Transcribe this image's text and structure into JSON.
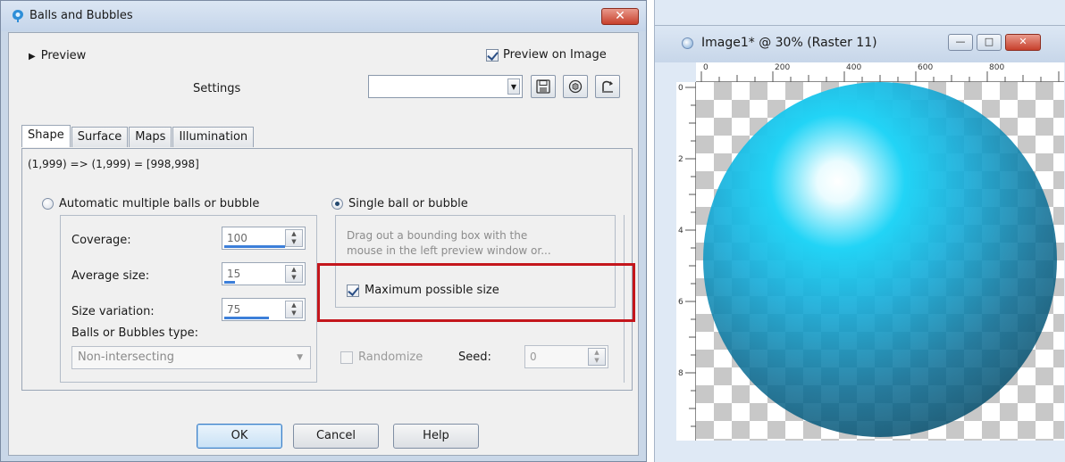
{
  "dialog": {
    "title": "Balls and Bubbles",
    "close_glyph": "✕",
    "preview_label": "Preview",
    "preview_on_image_label": "Preview on Image",
    "preview_on_image_checked": true,
    "settings_label": "Settings",
    "settings_value": "",
    "tabs": [
      {
        "label": "Shape",
        "active": true
      },
      {
        "label": "Surface",
        "active": false
      },
      {
        "label": "Maps",
        "active": false
      },
      {
        "label": "Illumination",
        "active": false
      }
    ],
    "coords_text": "(1,999) => (1,999) = [998,998]",
    "automatic_label": "Automatic multiple balls or bubble",
    "single_label": "Single ball or bubble",
    "coverage_label": "Coverage:",
    "coverage_value": "100",
    "average_size_label": "Average size:",
    "average_size_value": "15",
    "size_variation_label": "Size variation:",
    "size_variation_value": "75",
    "type_label": "Balls or Bubbles type:",
    "type_value": "Non-intersecting",
    "hint_line1": "Drag out a bounding box with the",
    "hint_line2": "mouse in the left preview window or...",
    "max_size_label": "Maximum possible size",
    "max_size_checked": true,
    "randomize_label": "Randomize",
    "seed_label": "Seed:",
    "seed_value": "0",
    "ok_label": "OK",
    "cancel_label": "Cancel",
    "help_label": "Help",
    "highlight_color": "#c4161c"
  },
  "image_window": {
    "title": "Image1* @  30% (Raster 11)",
    "ruler_top": [
      "0",
      "200",
      "400",
      "600",
      "800"
    ],
    "ruler_left": [
      "0",
      "2",
      "4",
      "6",
      "8"
    ],
    "minimize_glyph": "—",
    "maximize_glyph": "□",
    "close_glyph": "✕"
  }
}
